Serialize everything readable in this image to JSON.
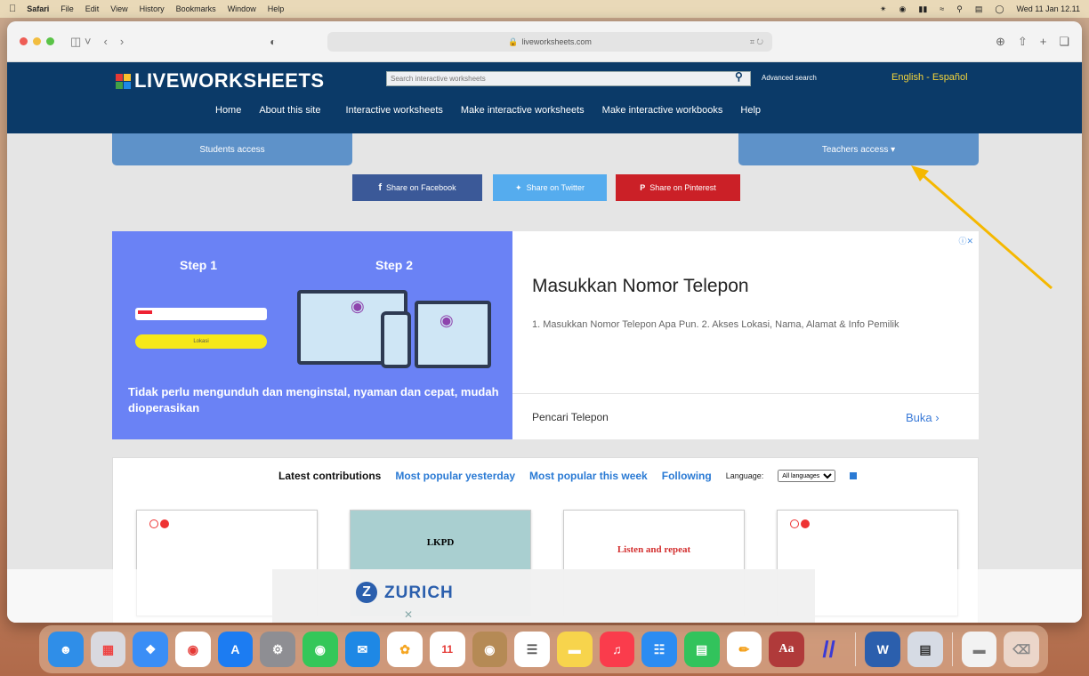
{
  "menubar": {
    "items": [
      "Safari",
      "File",
      "Edit",
      "View",
      "History",
      "Bookmarks",
      "Window",
      "Help"
    ],
    "datetime": "Wed 11 Jan 12.11"
  },
  "browser": {
    "url": "liveworksheets.com",
    "url_right": "⌗ ↻"
  },
  "site": {
    "logo": "LIVEWORKSHEETS",
    "search_placeholder": "Search interactive worksheets",
    "advanced_search": "Advanced search",
    "language_link": "English - Español",
    "nav": [
      "Home",
      "About this site",
      "Interactive worksheets",
      "Make interactive worksheets",
      "Make interactive workbooks",
      "Help"
    ],
    "students_access": "Students access",
    "teachers_access": "Teachers access ▾",
    "share_facebook": "Share on Facebook",
    "share_twitter": "Share on Twitter",
    "share_pinterest": "Share on Pinterest"
  },
  "ad": {
    "step1": "Step 1",
    "step2": "Step 2",
    "button": "Lokasi",
    "tagline": "Tidak perlu mengunduh dan menginstal, nyaman dan cepat, mudah dioperasikan",
    "title": "Masukkan Nomor Telepon",
    "description": "1. Masukkan Nomor Telepon Apa Pun. 2. Akses Lokasi, Nama, Alamat & Info Pemilik",
    "footer": "Pencari Telepon",
    "open": "Buka ›",
    "adchoices": "ⓘ✕"
  },
  "latest": {
    "tabs": [
      "Latest contributions",
      "Most popular yesterday",
      "Most popular this week",
      "Following"
    ],
    "language_label": "Language:",
    "language_value": "All languages",
    "cards": [
      "",
      "LKPD",
      "Listen and repeat",
      ""
    ]
  },
  "overlay": {
    "brand": "ZURICH",
    "close": "✕"
  },
  "colors": {
    "header": "#0b3a68",
    "tab": "#5e92c9",
    "facebook": "#3b5998",
    "twitter": "#55acee",
    "pinterest": "#cb2027",
    "arrow": "#f5b800"
  }
}
